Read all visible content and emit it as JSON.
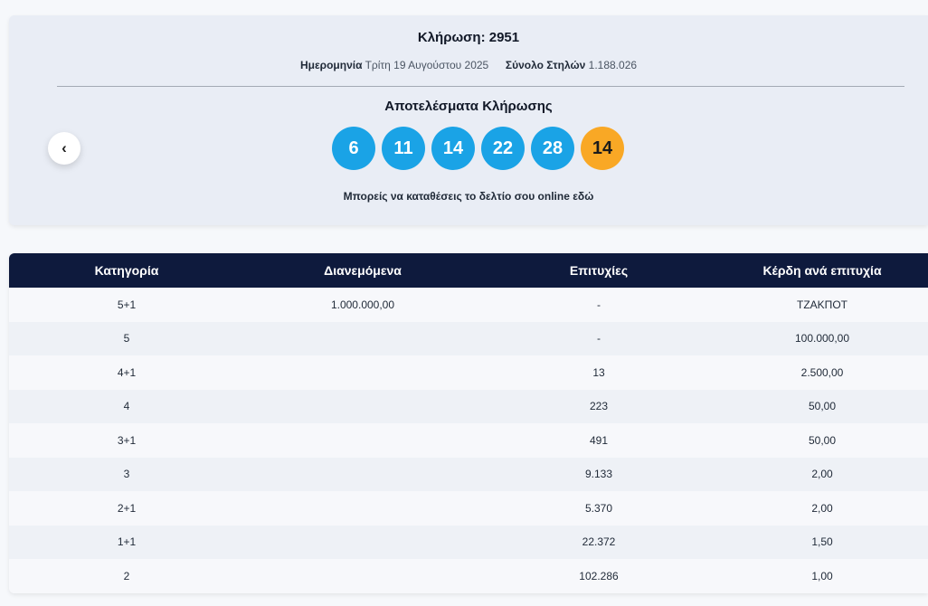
{
  "draw": {
    "title": "Κλήρωση: 2951",
    "date_label": "Ημερομηνία",
    "date_value": "Τρίτη 19 Αυγούστου 2025",
    "columns_label": "Σύνολο Στηλών",
    "columns_value": "1.188.026",
    "results_title": "Αποτελέσματα Κλήρωσης",
    "numbers": [
      "6",
      "11",
      "14",
      "22",
      "28"
    ],
    "bonus": "14",
    "online_text": "Μπορείς να καταθέσεις το δελτίο σου online εδώ",
    "colors": {
      "ball": "#1aa3e6",
      "bonus": "#f9a825",
      "header": "#0e1a3d"
    }
  },
  "table": {
    "headers": [
      "Κατηγορία",
      "Διανεμόμενα",
      "Επιτυχίες",
      "Κέρδη ανά επιτυχία"
    ],
    "rows": [
      [
        "5+1",
        "1.000.000,00",
        "-",
        "ΤΖΑΚΠΟΤ"
      ],
      [
        "5",
        "",
        "-",
        "100.000,00"
      ],
      [
        "4+1",
        "",
        "13",
        "2.500,00"
      ],
      [
        "4",
        "",
        "223",
        "50,00"
      ],
      [
        "3+1",
        "",
        "491",
        "50,00"
      ],
      [
        "3",
        "",
        "9.133",
        "2,00"
      ],
      [
        "2+1",
        "",
        "5.370",
        "2,00"
      ],
      [
        "1+1",
        "",
        "22.372",
        "1,50"
      ],
      [
        "2",
        "",
        "102.286",
        "1,00"
      ]
    ]
  }
}
